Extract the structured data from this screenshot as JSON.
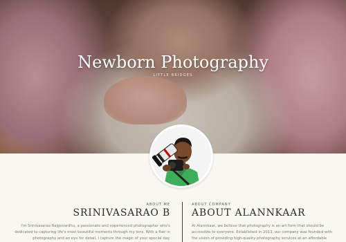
{
  "hero": {
    "title": "Newborn Photography",
    "subtitle": "LITTLE BRIDGES"
  },
  "about_me": {
    "label": "ABOUT ME",
    "title": "SRINIVASARAO B",
    "text": "I'm Srinivasarao Rajgovardhu, a passionate and experienced photographer who's dedicated to capturing life's most beautiful moments through my lens. With a flair in photography and an eye for detail, I capture the magic of your special day."
  },
  "about_company": {
    "label": "ABOUT COMPANY",
    "title": "ABOUT ALANNKAAR",
    "text": "At Alannkaar, we believe that photography is an art form that should be accessible to everyone. Established in 2013, our company was founded with the vision of providing high-quality photography services at an affordable price."
  },
  "colors": {
    "background": "#faf7f3",
    "title_text": "#2b2b2b",
    "body_text": "#777777",
    "hero_text": "#ffffff"
  },
  "icons": {
    "avatar": "photographer-portrait"
  }
}
